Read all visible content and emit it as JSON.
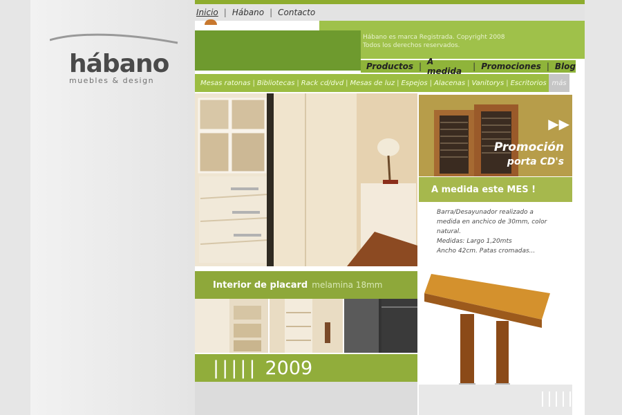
{
  "brand": {
    "name": "hábano",
    "tagline": "muebles & design"
  },
  "top_nav": {
    "items": [
      "Inicio",
      "Hábano",
      "Contacto"
    ],
    "active_index": 0
  },
  "copyright": {
    "line1": "Hábano es marca Registrada. Copyright 2008",
    "line2": "Todos los derechos reservados."
  },
  "section_nav": {
    "items": [
      "Productos",
      "A medida",
      "Promociones",
      "Blog"
    ]
  },
  "categories": [
    "Mesas ratonas",
    "Bibliotecas",
    "Rack cd/dvd",
    "Mesas de luz",
    "Espejos",
    "Alacenas",
    "Vanitorys",
    "Escritorios"
  ],
  "categories_more": "más",
  "feature": {
    "title": "Interior de placard",
    "subtitle": "melamina 18mm",
    "year": "2009"
  },
  "promo": {
    "line1": "Promoción",
    "line2": "porta CD's"
  },
  "month": {
    "title": "A medida este MES !",
    "desc": [
      "Barra/Desayunador realizado a",
      "medida en anchico de 30mm, color",
      "natural.",
      "Medidas:  Largo 1,20mts",
      "Ancho 42cm. Patas cromadas..."
    ]
  },
  "colors": {
    "accent_green": "#8ea83a",
    "dark_green": "#6e9a2e",
    "promo_gold": "#b79d4a"
  }
}
